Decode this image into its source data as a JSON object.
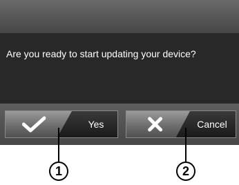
{
  "dialog": {
    "message": "Are you ready to start updating your device?"
  },
  "buttons": {
    "yes": {
      "label": "Yes",
      "icon": "checkmark-icon"
    },
    "cancel": {
      "label": "Cancel",
      "icon": "cross-icon"
    }
  },
  "callouts": [
    {
      "label": "1"
    },
    {
      "label": "2"
    }
  ],
  "colors": {
    "dialog_background": "#282828",
    "button_border": "#8a8a8a",
    "text": "#ffffff"
  }
}
